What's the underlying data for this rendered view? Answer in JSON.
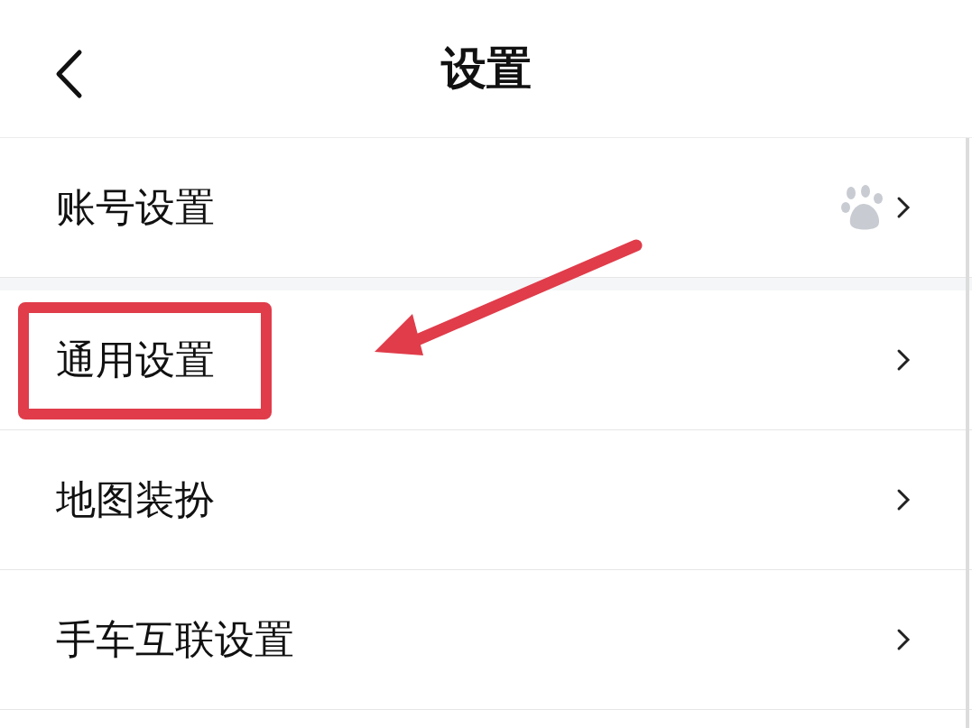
{
  "header": {
    "title": "设置"
  },
  "rows": [
    {
      "label": "账号设置",
      "kind": "account",
      "highlighted": false
    },
    {
      "label": "通用设置",
      "kind": "link",
      "highlighted": true
    },
    {
      "label": "地图装扮",
      "kind": "link",
      "highlighted": false
    },
    {
      "label": "手车互联设置",
      "kind": "link",
      "highlighted": false
    }
  ]
}
